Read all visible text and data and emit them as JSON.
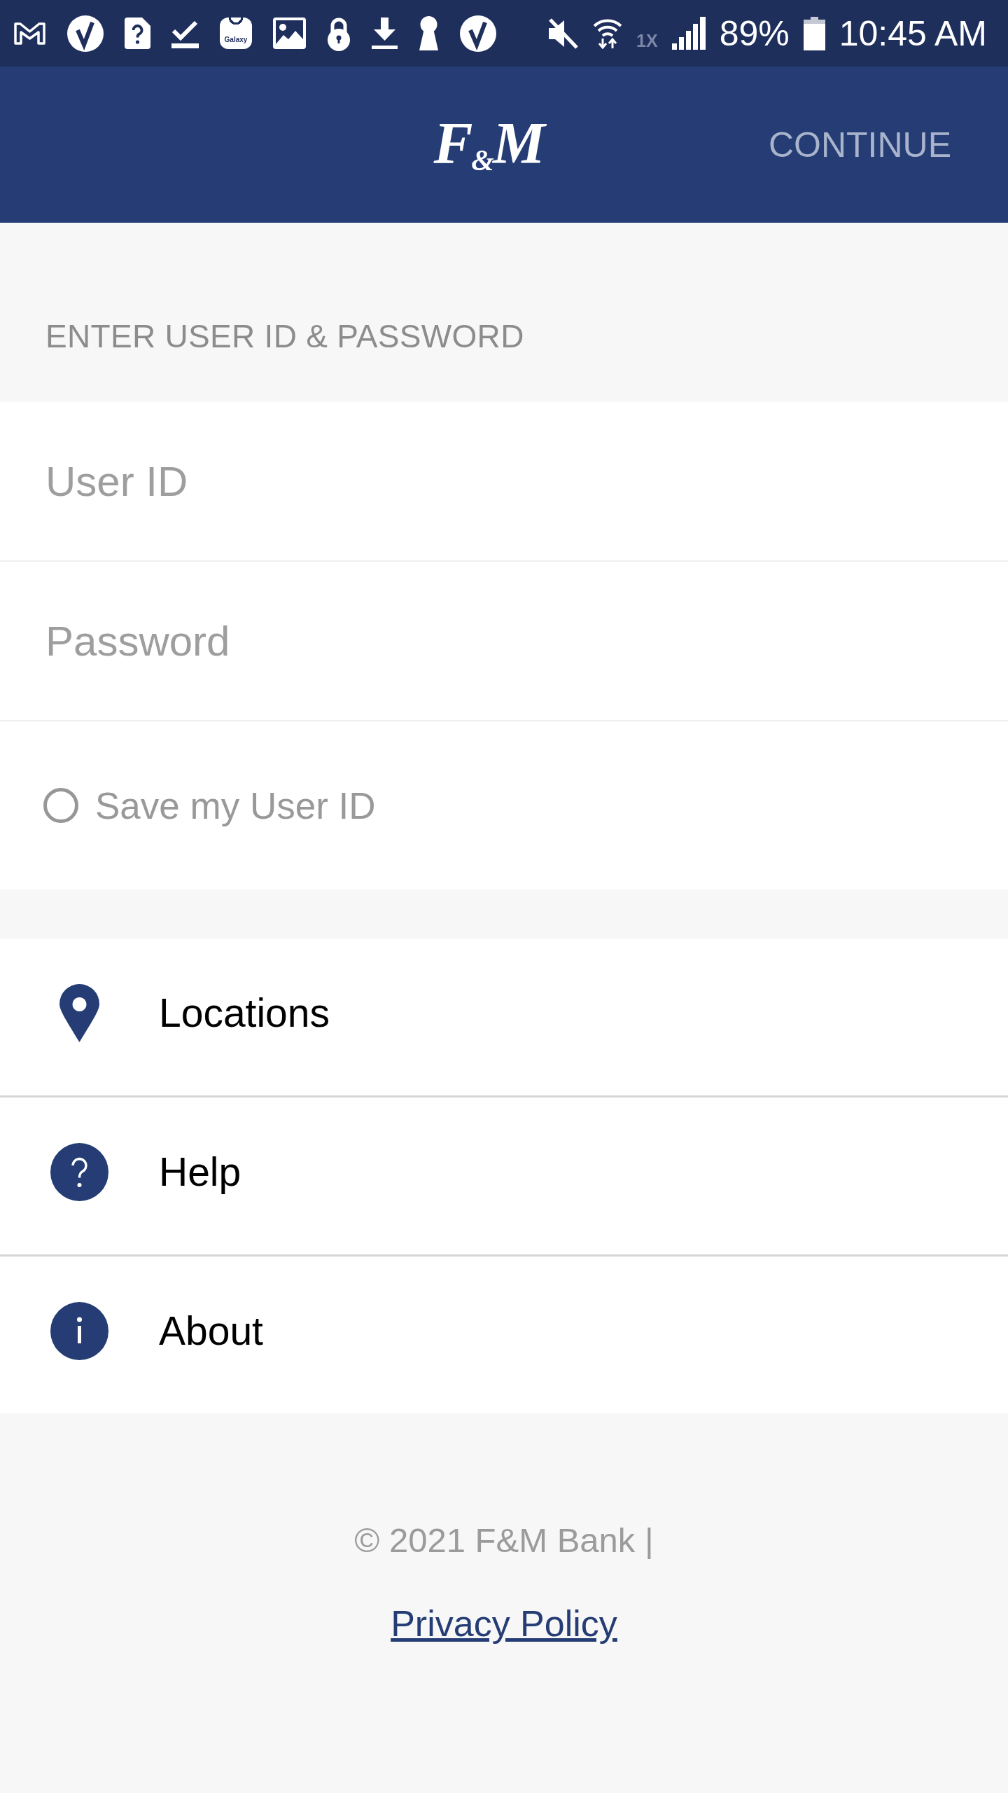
{
  "status_bar": {
    "app_icon_label": "Galaxy",
    "network_type": "1X",
    "battery": "89%",
    "time": "10:45 AM"
  },
  "header": {
    "logo": "F$_{&}$M",
    "continue_button": "CONTINUE"
  },
  "login": {
    "section_title": "ENTER USER ID & PASSWORD",
    "fields": [
      {
        "placeholder": "User ID"
      },
      {
        "placeholder": "Password"
      }
    ],
    "save_user_id": {
      "label": "Save my User ID",
      "checked": false
    }
  },
  "menu": [
    {
      "label": "Locations",
      "kind": "location"
    },
    {
      "label": "Help",
      "kind": "help"
    },
    {
      "label": "About",
      "kind": "about"
    }
  ],
  "footer": {
    "copyright": "© 2021 F&M Bank |",
    "link": "Privacy Policy"
  }
}
